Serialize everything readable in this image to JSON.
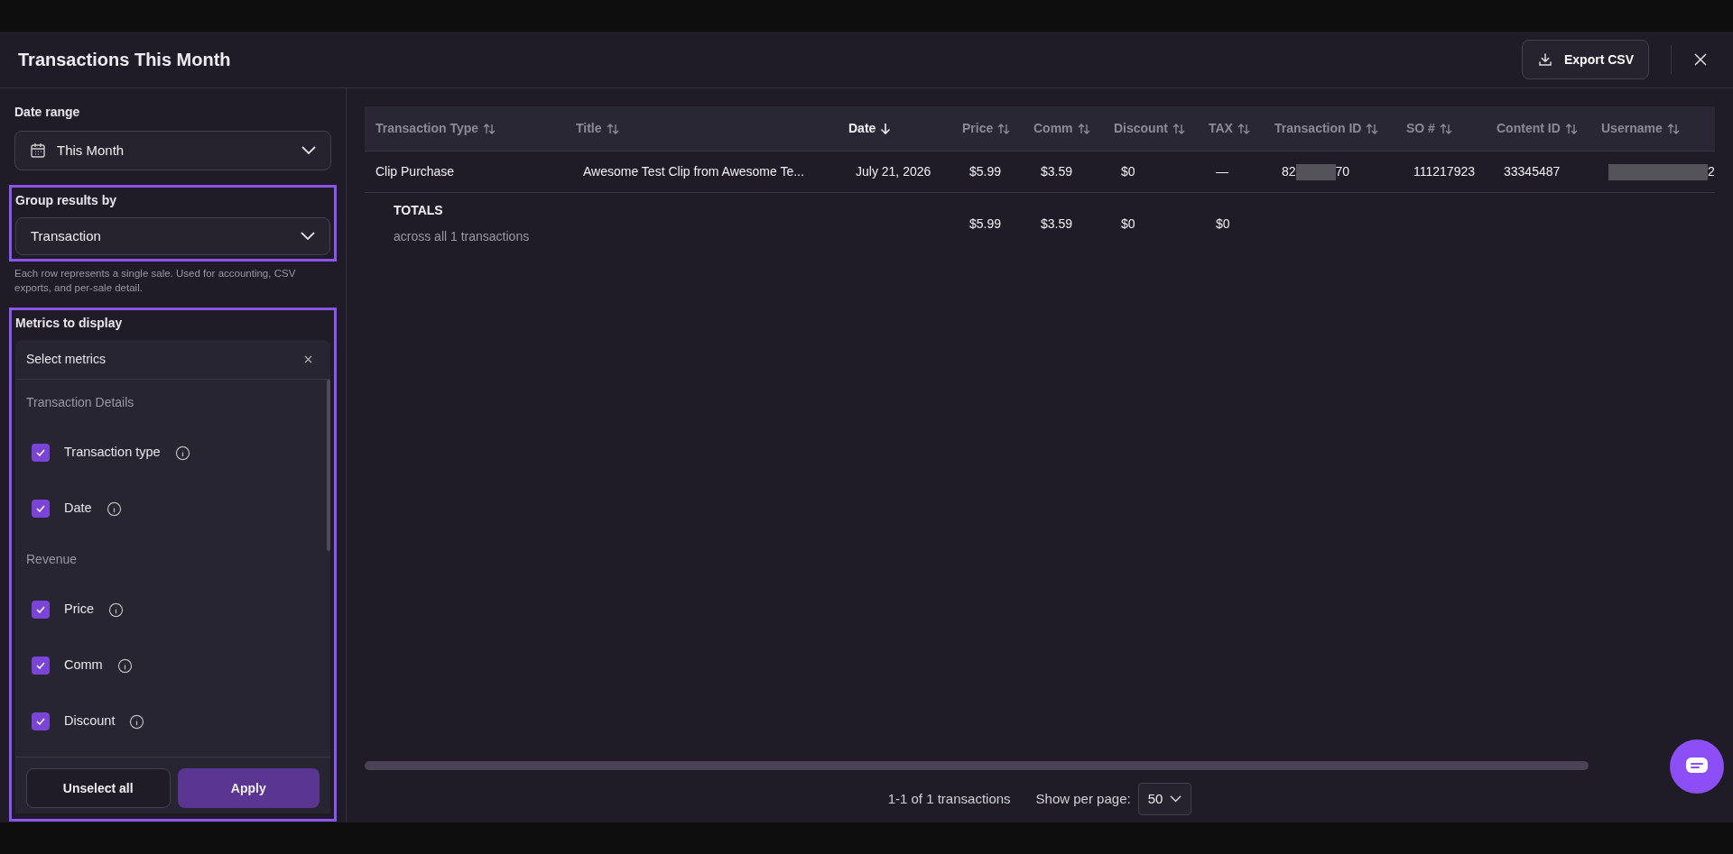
{
  "dialog": {
    "title": "Transactions This Month",
    "export_button": "Export CSV"
  },
  "filters": {
    "date_range": {
      "label": "Date range",
      "value": "This Month"
    },
    "group_by": {
      "label": "Group results by",
      "value": "Transaction",
      "highlighted": true,
      "description": "Each row represents a single sale. Used for accounting, CSV exports, and per-sale detail."
    },
    "metrics": {
      "label": "Metrics to display",
      "highlighted": true,
      "header": "Select metrics",
      "groups": [
        {
          "title": "Transaction Details",
          "items": [
            {
              "label": "Transaction type",
              "checked": true
            },
            {
              "label": "Date",
              "checked": true
            }
          ]
        },
        {
          "title": "Revenue",
          "items": [
            {
              "label": "Price",
              "checked": true
            },
            {
              "label": "Comm",
              "checked": true
            },
            {
              "label": "Discount",
              "checked": true
            }
          ]
        }
      ],
      "buttons": {
        "secondary": "Unselect all",
        "primary": "Apply"
      }
    }
  },
  "table": {
    "columns": [
      {
        "label": "Transaction Type",
        "sorted": false
      },
      {
        "label": "Title",
        "sorted": false
      },
      {
        "label": "Date",
        "sorted": true
      },
      {
        "label": "Price",
        "sorted": false
      },
      {
        "label": "Comm",
        "sorted": false
      },
      {
        "label": "Discount",
        "sorted": false
      },
      {
        "label": "TAX",
        "sorted": false
      },
      {
        "label": "Transaction ID",
        "sorted": false
      },
      {
        "label": "SO #",
        "sorted": false
      },
      {
        "label": "Content ID",
        "sorted": false
      },
      {
        "label": "Username",
        "sorted": false
      }
    ],
    "rows": [
      {
        "cells": [
          {
            "kind": "text",
            "text": "Clip Purchase"
          },
          {
            "kind": "text",
            "text": "Awesome Test Clip from Awesome Te..."
          },
          {
            "kind": "text",
            "text": "July 21, 2026"
          },
          {
            "kind": "text",
            "text": "$5.99"
          },
          {
            "kind": "text",
            "text": "$3.59"
          },
          {
            "kind": "text",
            "text": "$0"
          },
          {
            "kind": "text",
            "text": "—"
          },
          {
            "kind": "redacted",
            "prefix": "82",
            "suffix": "70"
          },
          {
            "kind": "text",
            "text": "111217923"
          },
          {
            "kind": "text",
            "text": "33345487"
          },
          {
            "kind": "redacted",
            "suffix": "2"
          }
        ]
      }
    ],
    "totals": {
      "label": "TOTALS",
      "sublabel": "across all 1 transactions",
      "cells": [
        "",
        "",
        "",
        "$5.99",
        "$3.59",
        "$0",
        "$0",
        "",
        "",
        "",
        ""
      ]
    }
  },
  "pagination": {
    "summary": "1-1 of 1 transactions",
    "per_page_label": "Show per page:",
    "per_page": "50"
  }
}
